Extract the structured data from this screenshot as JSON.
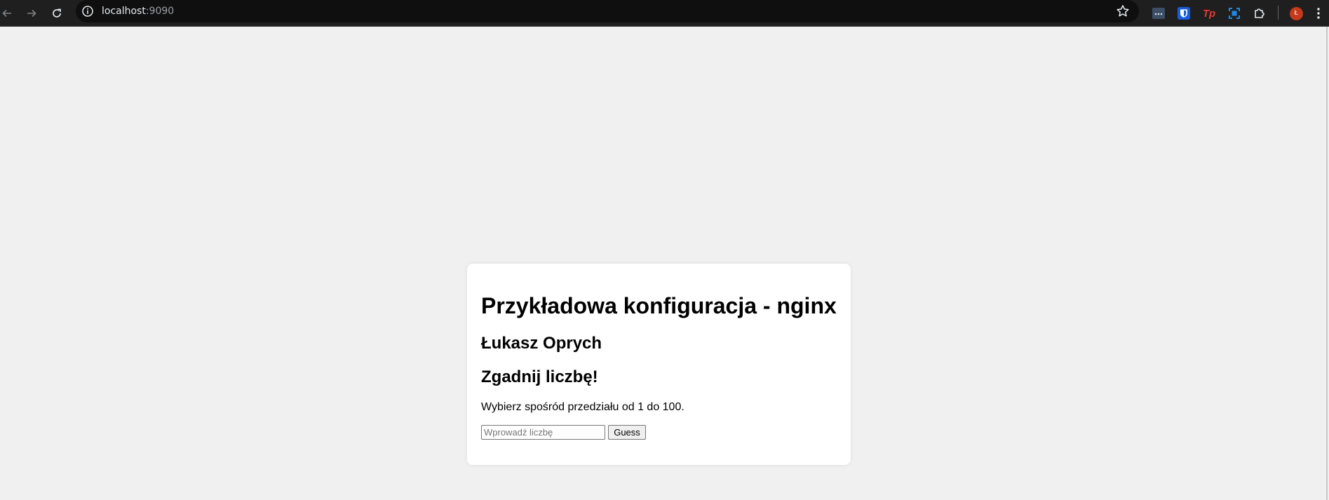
{
  "browser": {
    "url_host": "localhost",
    "url_port": ":9090",
    "icons": {
      "back": "arrow-left-icon",
      "forward": "arrow-right-icon",
      "reload": "reload-icon",
      "site_info": "info-icon",
      "bookmark": "star-icon",
      "menu": "kebab-menu-icon"
    },
    "extensions": [
      {
        "name": "dots-extension-icon",
        "color": "#5f7fa6"
      },
      {
        "name": "bitwarden-shield-icon",
        "color": "#175ddc"
      },
      {
        "name": "tp-extension-icon",
        "label": "Tp",
        "color": "#e53935"
      },
      {
        "name": "screenshot-extension-icon",
        "color": "#1e88e5"
      },
      {
        "name": "puzzle-extensions-icon",
        "color": "#e8eaed"
      }
    ],
    "profile_initial": "Ł",
    "profile_color": "#c6391b"
  },
  "page": {
    "title": "Przykładowa konfiguracja - nginx",
    "author": "Łukasz Oprych",
    "game_title": "Zgadnij liczbę!",
    "description": "Wybierz spośród przedziału od 1 do 100.",
    "input_placeholder": "Wprowadź liczbę",
    "input_value": "",
    "guess_label": "Guess"
  }
}
